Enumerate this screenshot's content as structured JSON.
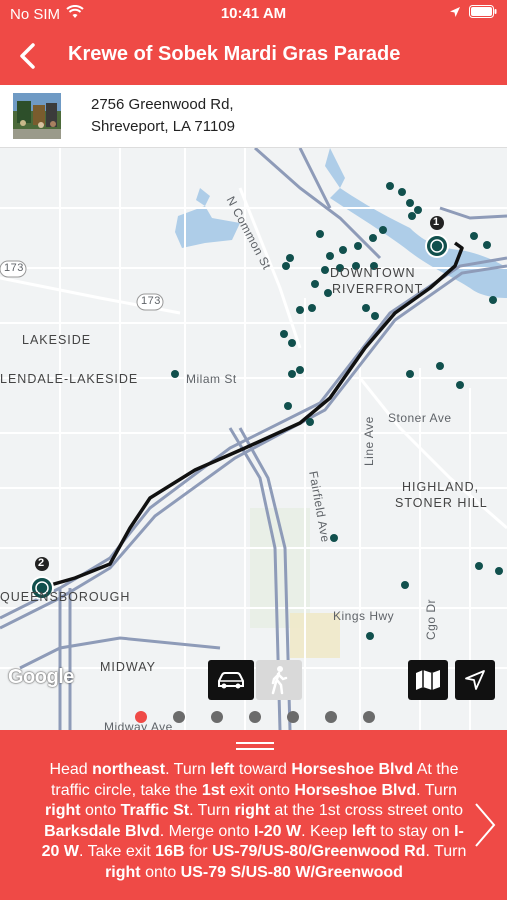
{
  "status_bar": {
    "carrier": "No SIM",
    "time": "10:41 AM"
  },
  "nav": {
    "title": "Krewe of Sobek Mardi Gras Parade"
  },
  "address": {
    "line1": "2756 Greenwood Rd,",
    "line2": "Shreveport, LA 71109"
  },
  "map": {
    "labels": {
      "n_common": "N Common St",
      "downtown": "DOWNTOWN",
      "riverfront": "RIVERFRONT",
      "hwy173_a": "173",
      "hwy173_b": "173",
      "lakeside": "LAKESIDE",
      "glendale": "LENDALE-LAKESIDE",
      "milam": "Milam St",
      "stoner": "Stoner Ave",
      "line_ave": "Line Ave",
      "highland1": "HIGHLAND,",
      "highland2": "STONER HILL",
      "fairfield": "Fairfield Ave",
      "queensborough": "QUEENSBOROUGH",
      "kings_hwy": "Kings Hwy",
      "midway": "MIDWAY",
      "midway_ave": "Midway Ave",
      "cgo_dr": "Cgo Dr"
    },
    "markers": {
      "start": "1",
      "end": "2"
    },
    "google": "Google"
  },
  "page_indicator": {
    "count": 7,
    "active_index": 0
  },
  "directions": {
    "segments": [
      {
        "t": "Head ",
        "b": false
      },
      {
        "t": "northeast",
        "b": true
      },
      {
        "t": ". Turn ",
        "b": false
      },
      {
        "t": "left",
        "b": true
      },
      {
        "t": " toward ",
        "b": false
      },
      {
        "t": "Horseshoe Blvd",
        "b": true
      },
      {
        "t": " At the traffic circle, take the ",
        "b": false
      },
      {
        "t": "1st",
        "b": true
      },
      {
        "t": " exit onto ",
        "b": false
      },
      {
        "t": "Horseshoe Blvd",
        "b": true
      },
      {
        "t": ". Turn ",
        "b": false
      },
      {
        "t": "right",
        "b": true
      },
      {
        "t": " onto ",
        "b": false
      },
      {
        "t": "Traffic St",
        "b": true
      },
      {
        "t": ". Turn ",
        "b": false
      },
      {
        "t": "right",
        "b": true
      },
      {
        "t": " at the 1st cross street onto ",
        "b": false
      },
      {
        "t": "Barksdale Blvd",
        "b": true
      },
      {
        "t": ". Merge onto ",
        "b": false
      },
      {
        "t": "I-20 W",
        "b": true
      },
      {
        "t": ". Keep ",
        "b": false
      },
      {
        "t": "left",
        "b": true
      },
      {
        "t": " to stay on ",
        "b": false
      },
      {
        "t": "I-20 W",
        "b": true
      },
      {
        "t": ". Take exit ",
        "b": false
      },
      {
        "t": "16B",
        "b": true
      },
      {
        "t": " for ",
        "b": false
      },
      {
        "t": "US-79/US-80/Greenwood Rd",
        "b": true
      },
      {
        "t": ". Turn ",
        "b": false
      },
      {
        "t": "right",
        "b": true
      },
      {
        "t": " onto ",
        "b": false
      },
      {
        "t": "US-79 S/US-80 W/Greenwood",
        "b": true
      }
    ]
  }
}
